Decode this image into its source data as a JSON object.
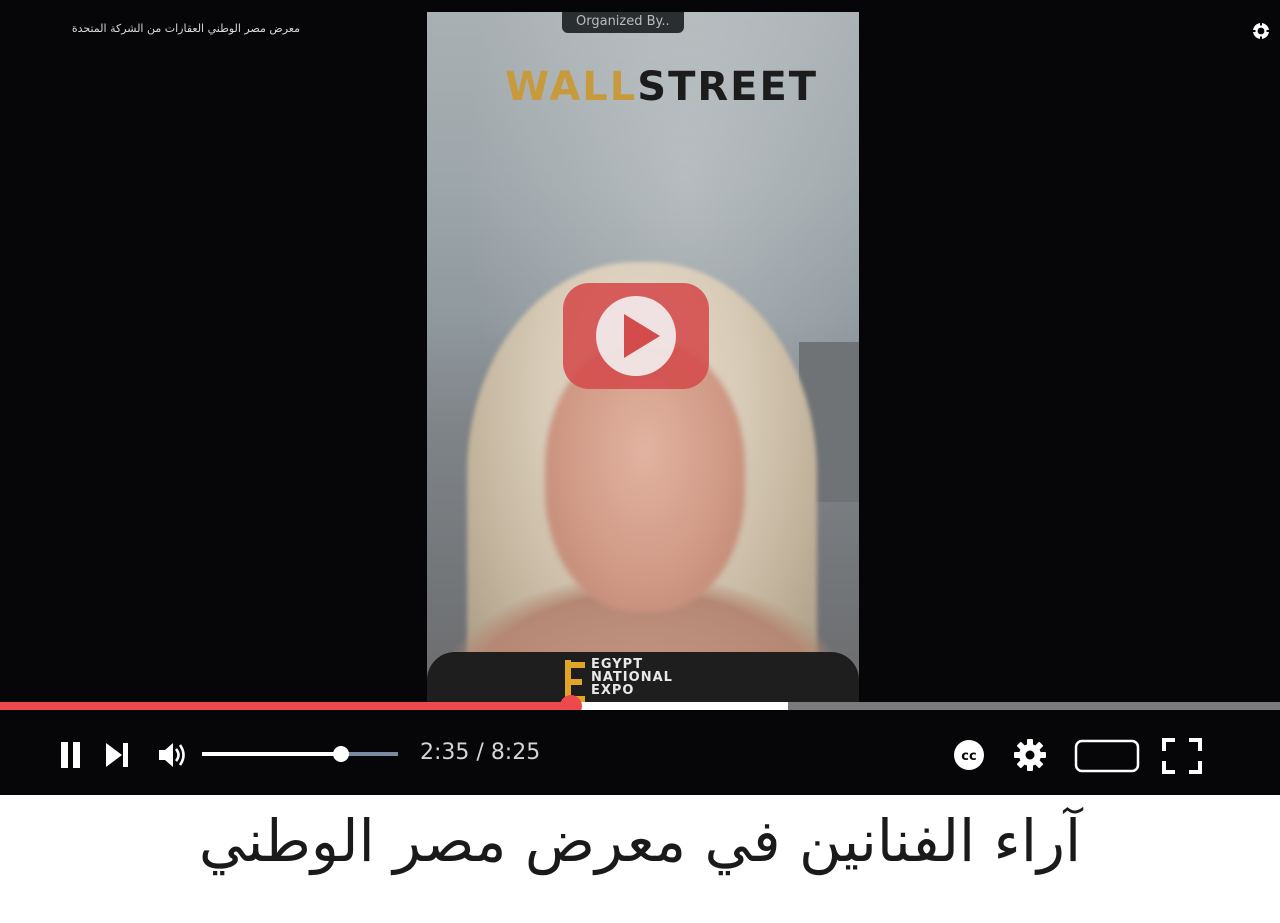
{
  "player": {
    "video_title": "معرض مصر الوطني العقارات من الشركة المتحدة",
    "organized_badge": "Organized By..",
    "logo": {
      "wall": "WALL",
      "street": "STREET"
    },
    "expo": {
      "line1": "EGYPT",
      "line2": "NATIONAL",
      "line3": "EXPO"
    },
    "progress": {
      "played_fraction": 0.446,
      "buffered_fraction": 0.616
    },
    "volume": {
      "level_fraction": 0.71
    },
    "time": {
      "current": "2:35",
      "separator": " / ",
      "duration": "8:25",
      "display": "2:35 / 8:25"
    },
    "colors": {
      "progress_played": "#ee4a4e",
      "progress_buffered": "#ffffff",
      "progress_track": "#7b7b7b",
      "play_button": "#d44b4b",
      "background": "#060608"
    },
    "icons": [
      "pause-icon",
      "next-icon",
      "volume-icon",
      "captions-icon",
      "settings-icon",
      "theater-mode-icon",
      "fullscreen-icon",
      "play-icon",
      "info-icon"
    ]
  },
  "caption": {
    "text": "آراء الفنانين في معرض مصر الوطني"
  }
}
